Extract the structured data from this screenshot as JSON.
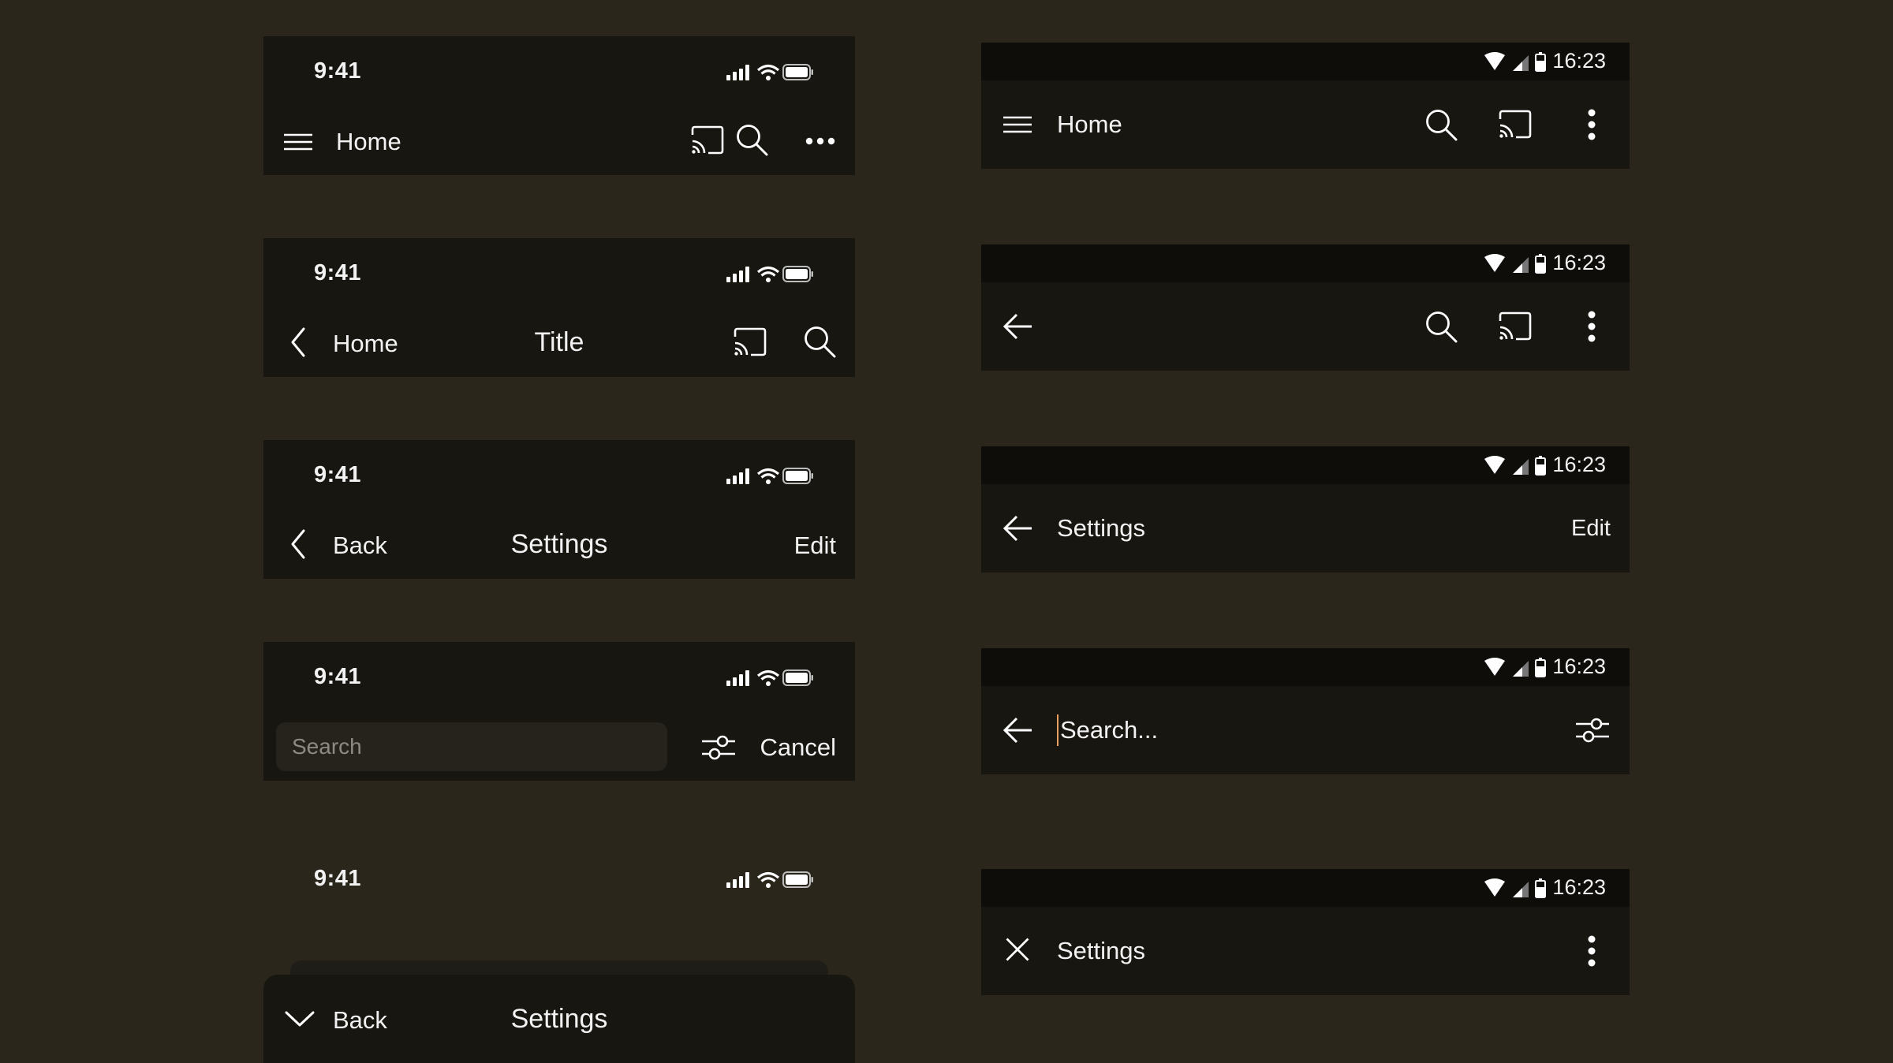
{
  "ios": {
    "status_time": "9:41",
    "bars": [
      {
        "left_label": "Home",
        "title": "",
        "right_label": "",
        "left_icon": "menu-icon",
        "right_icons": [
          "cast-icon",
          "search-icon",
          "more-horizontal-icon"
        ]
      },
      {
        "left_label": "Home",
        "title": "Title",
        "right_label": "",
        "left_icon": "chevron-left-icon",
        "right_icons": [
          "cast-icon",
          "search-icon"
        ]
      },
      {
        "left_label": "Back",
        "title": "Settings",
        "right_label": "Edit",
        "left_icon": "chevron-left-icon",
        "right_icons": []
      },
      {
        "search_placeholder": "Search",
        "right_label": "Cancel",
        "right_icons": [
          "filter-sliders-icon"
        ]
      },
      {
        "left_label": "Back",
        "title": "Settings",
        "left_icon": "chevron-down-icon"
      }
    ]
  },
  "android": {
    "status_time": "16:23",
    "bars": [
      {
        "title": "Home",
        "left_icon": "menu-icon",
        "right_icons": [
          "search-icon",
          "cast-icon",
          "more-vertical-icon"
        ]
      },
      {
        "title": "",
        "left_icon": "arrow-back-icon",
        "right_icons": [
          "search-icon",
          "cast-icon",
          "more-vertical-icon"
        ]
      },
      {
        "title": "Settings",
        "left_icon": "arrow-back-icon",
        "right_label": "Edit"
      },
      {
        "search_value": "Search...",
        "left_icon": "arrow-back-icon",
        "right_icons": [
          "filter-sliders-icon"
        ]
      },
      {
        "title": "Settings",
        "left_icon": "close-icon",
        "right_icons": [
          "more-vertical-icon"
        ]
      }
    ]
  },
  "colors": {
    "background": "#2b261b",
    "bar": "#171611",
    "android_statusbar": "#0e0d0a",
    "text": "#f2f2f2",
    "cursor": "#e8a060"
  }
}
